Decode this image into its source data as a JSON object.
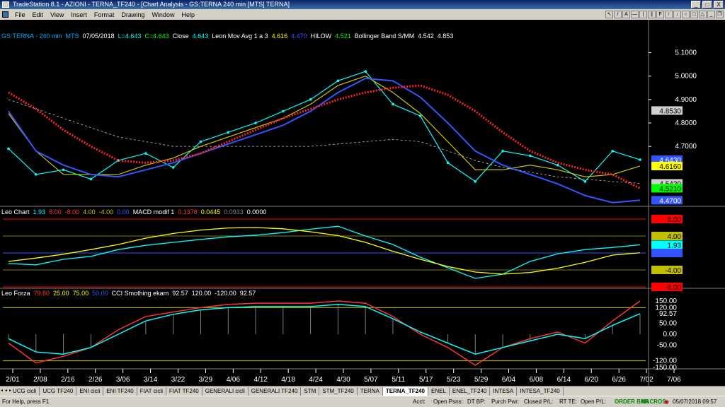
{
  "window": {
    "title": "TradeStation 8.1 - AZIONI - TERNA_TF240 - [Chart Analysis - GS:TERNA  240 min  [MTS] TERNA]",
    "minimize": "_",
    "maximize": "□",
    "close": "X"
  },
  "menu": [
    "File",
    "Edit",
    "View",
    "Insert",
    "Format",
    "Drawing",
    "Window",
    "Help"
  ],
  "chart_title": "GS:TERNA - 240 min   MTS  07/05/2018  L=4.643  C=4.643  Close",
  "legends": {
    "price": [
      {
        "text": "GS:TERNA - 240 min",
        "color": "#00aaff"
      },
      {
        "text": "MTS",
        "color": "#00aaff"
      },
      {
        "text": "07/05/2018",
        "color": "#ffffff"
      },
      {
        "text": "L=4.643",
        "color": "#00ffff"
      },
      {
        "text": "C=4.643",
        "color": "#00ff00"
      },
      {
        "text": "Close",
        "color": "#ffffff"
      },
      {
        "text": "4.643",
        "color": "#00ffff"
      },
      {
        "text": "Leon Mov Avg 1 a 3",
        "color": "#ffffff"
      },
      {
        "text": "4.616",
        "color": "#ffff00"
      },
      {
        "text": "4.470",
        "color": "#3355ff"
      },
      {
        "text": "HILOW",
        "color": "#ffffff"
      },
      {
        "text": "4.521",
        "color": "#00ff00"
      },
      {
        "text": "Bollinger Band S/MM",
        "color": "#ffffff"
      },
      {
        "text": "4.542",
        "color": "#ffffff"
      },
      {
        "text": "4.853",
        "color": "#ffffff"
      }
    ],
    "macd": [
      {
        "text": "Leo Chart",
        "color": "#ffffff"
      },
      {
        "text": "1.93",
        "color": "#00ffff"
      },
      {
        "text": "8.00",
        "color": "#ff3333"
      },
      {
        "text": "-8.00",
        "color": "#ff3333"
      },
      {
        "text": "4.00",
        "color": "#c0c000"
      },
      {
        "text": "-4.00",
        "color": "#c0c000"
      },
      {
        "text": "0.00",
        "color": "#3355ff"
      },
      {
        "text": "MACD modif 1",
        "color": "#ffffff"
      },
      {
        "text": "0.1378",
        "color": "#ff3333"
      },
      {
        "text": "0.0445",
        "color": "#ffff00"
      },
      {
        "text": "0.0933",
        "color": "#808080"
      },
      {
        "text": "0.0000",
        "color": "#ffffff"
      }
    ],
    "cci": [
      {
        "text": "Leo Forza",
        "color": "#ffffff"
      },
      {
        "text": "79.80",
        "color": "#ff3333"
      },
      {
        "text": "25.00",
        "color": "#ffff00"
      },
      {
        "text": "75.00",
        "color": "#ffff00"
      },
      {
        "text": "50.00",
        "color": "#3355ff"
      },
      {
        "text": "CCI Smothing ekam",
        "color": "#ffffff"
      },
      {
        "text": "92.57",
        "color": "#ffffff"
      },
      {
        "text": "120.00",
        "color": "#ffffff"
      },
      {
        "text": "-120.00",
        "color": "#ffffff"
      },
      {
        "text": "92.57",
        "color": "#ffffff"
      }
    ]
  },
  "price_axis": {
    "ticks": [
      "5.1000",
      "5.0000",
      "4.9000",
      "4.8000",
      "4.7000"
    ],
    "badges": [
      {
        "text": "4.8530",
        "bg": "#d0d0d0",
        "fg": "#000000"
      },
      {
        "text": "4.6430",
        "bg": "#3355ff",
        "fg": "#ffffff"
      },
      {
        "text": "4.6160",
        "bg": "#ffff00",
        "fg": "#000000"
      },
      {
        "text": "4.5420",
        "bg": "#d0d0d0",
        "fg": "#000000"
      },
      {
        "text": "4.5210",
        "bg": "#00ff00",
        "fg": "#000000"
      },
      {
        "text": "4.4700",
        "bg": "#3355ff",
        "fg": "#ffffff"
      }
    ]
  },
  "macd_axis": {
    "badges": [
      {
        "text": "8.00",
        "bg": "#ff0000",
        "fg": "#000000"
      },
      {
        "text": "4.00",
        "bg": "#c0c000",
        "fg": "#000000"
      },
      {
        "text": "1.93",
        "bg": "#00ffff",
        "fg": "#000000"
      },
      {
        "text": "",
        "bg": "#3355ff",
        "fg": "#ffffff"
      },
      {
        "text": "-4.00",
        "bg": "#c0c000",
        "fg": "#000000"
      },
      {
        "text": "-8.00",
        "bg": "#ff0000",
        "fg": "#000000"
      }
    ]
  },
  "cci_axis": {
    "ticks": [
      "150.00",
      "120.00",
      "92.57",
      "50.00",
      "0.00",
      "-50.00",
      "-120.00",
      "-150.00"
    ]
  },
  "time_axis": [
    "2/01",
    "2/08",
    "2/16",
    "2/26",
    "3/06",
    "3/14",
    "3/22",
    "3/29",
    "4/06",
    "4/12",
    "4/18",
    "4/24",
    "4/30",
    "5/07",
    "5/11",
    "5/17",
    "5/23",
    "5/29",
    "6/04",
    "6/08",
    "6/14",
    "6/20",
    "6/26",
    "7/02",
    "7/06"
  ],
  "tabs": [
    "UCG cicli",
    "UCG TF240",
    "ENI cicli",
    "ENI TF240",
    "FIAT cicli",
    "FIAT TF240",
    "GENERALI cicli",
    "GENERALI TF240",
    "STM",
    "STM_TF240",
    "TERNA",
    "TERNA_TF240",
    "ENEL",
    "ENEL_TF240",
    "INTESA",
    "INTESA_TF240"
  ],
  "active_tab": "TERNA_TF240",
  "status": {
    "help": "For Help, press F1",
    "acct": "Acct:",
    "open_psns": "Open Psns:",
    "dt_bp": "DT BP:",
    "purch_pwr": "Purch Pwr:",
    "closed_pl": "Closed P/L:",
    "rt_te": "RT TE:",
    "open_pl": "Open P/L:",
    "order_bar": "ORDER BAR",
    "macros": "MACROS",
    "datetime": "05/07/2018 09:57"
  },
  "chart_data": [
    {
      "type": "line",
      "title": "GS:TERNA - 240 min",
      "x": [
        "2/01",
        "2/08",
        "2/16",
        "2/26",
        "3/06",
        "3/14",
        "3/22",
        "3/29",
        "4/06",
        "4/12",
        "4/18",
        "4/24",
        "4/30",
        "5/07",
        "5/11",
        "5/17",
        "5/23",
        "5/29",
        "6/04",
        "6/08",
        "6/14",
        "6/20",
        "6/26",
        "7/02"
      ],
      "series": [
        {
          "name": "Close",
          "values": [
            4.69,
            4.58,
            4.6,
            4.56,
            4.64,
            4.67,
            4.61,
            4.72,
            4.76,
            4.8,
            4.85,
            4.9,
            4.98,
            5.02,
            4.88,
            4.83,
            4.63,
            4.55,
            4.68,
            4.66,
            4.62,
            4.55,
            4.68,
            4.643
          ]
        },
        {
          "name": "Leon Mov Avg 1 a 3",
          "values": [
            4.84,
            4.68,
            4.58,
            4.58,
            4.58,
            4.62,
            4.65,
            4.7,
            4.74,
            4.78,
            4.82,
            4.88,
            4.96,
            5.0,
            4.93,
            4.84,
            4.72,
            4.6,
            4.6,
            4.62,
            4.6,
            4.57,
            4.58,
            4.616
          ]
        },
        {
          "name": "4.470",
          "values": [
            4.85,
            4.68,
            4.62,
            4.58,
            4.57,
            4.6,
            4.63,
            4.67,
            4.71,
            4.75,
            4.79,
            4.85,
            4.93,
            4.99,
            4.98,
            4.91,
            4.8,
            4.68,
            4.62,
            4.58,
            4.54,
            4.49,
            4.46,
            4.47
          ]
        },
        {
          "name": "HILOW",
          "values": [
            4.93,
            4.86,
            4.77,
            4.7,
            4.64,
            4.63,
            4.64,
            4.67,
            4.72,
            4.77,
            4.82,
            4.86,
            4.9,
            4.93,
            4.95,
            4.96,
            4.92,
            4.85,
            4.76,
            4.68,
            4.63,
            4.6,
            4.58,
            4.521
          ]
        },
        {
          "name": "Bollinger Band S/MM",
          "values": [
            4.9,
            4.86,
            4.82,
            4.78,
            4.74,
            4.72,
            4.7,
            4.7,
            4.7,
            4.7,
            4.7,
            4.7,
            4.71,
            4.72,
            4.73,
            4.72,
            4.68,
            4.64,
            4.61,
            4.59,
            4.57,
            4.56,
            4.55,
            4.542
          ]
        }
      ],
      "ylim": [
        4.45,
        5.15
      ]
    },
    {
      "type": "line",
      "title": "Leo Chart",
      "series": [
        {
          "name": "Leo Chart",
          "values": [
            -2.5,
            -2.8,
            -1.5,
            -0.8,
            0.8,
            1.8,
            2.5,
            3.2,
            3.8,
            4.2,
            4.8,
            5.6,
            6.3,
            4.0,
            2.0,
            -1.0,
            -3.5,
            -6.0,
            -5.0,
            -2.0,
            -0.2,
            0.8,
            1.3,
            1.93
          ]
        },
        {
          "name": "MACD modif 1",
          "values": [
            -2.0,
            -1.2,
            -0.3,
            0.8,
            2.0,
            3.5,
            4.6,
            5.4,
            5.9,
            6.0,
            5.7,
            5.0,
            4.1,
            2.5,
            0.4,
            -1.5,
            -3.2,
            -4.5,
            -5.0,
            -4.6,
            -3.6,
            -2.2,
            -0.5,
            0.0445
          ]
        }
      ],
      "ylim": [
        -8,
        8
      ]
    },
    {
      "type": "line",
      "title": "Leo Forza",
      "series": [
        {
          "name": "Leo Forza",
          "values": [
            -40,
            -130,
            -100,
            -60,
            20,
            80,
            100,
            120,
            135,
            140,
            140,
            140,
            150,
            140,
            80,
            0,
            -60,
            -140,
            -60,
            -20,
            10,
            -40,
            60,
            150
          ]
        },
        {
          "name": "CCI Smothing ekam",
          "values": [
            -20,
            -80,
            -90,
            -60,
            0,
            60,
            90,
            110,
            120,
            125,
            125,
            125,
            135,
            125,
            70,
            10,
            -40,
            -90,
            -60,
            -30,
            0,
            -20,
            40,
            92.57
          ]
        }
      ],
      "ylim": [
        -150,
        150
      ]
    }
  ]
}
